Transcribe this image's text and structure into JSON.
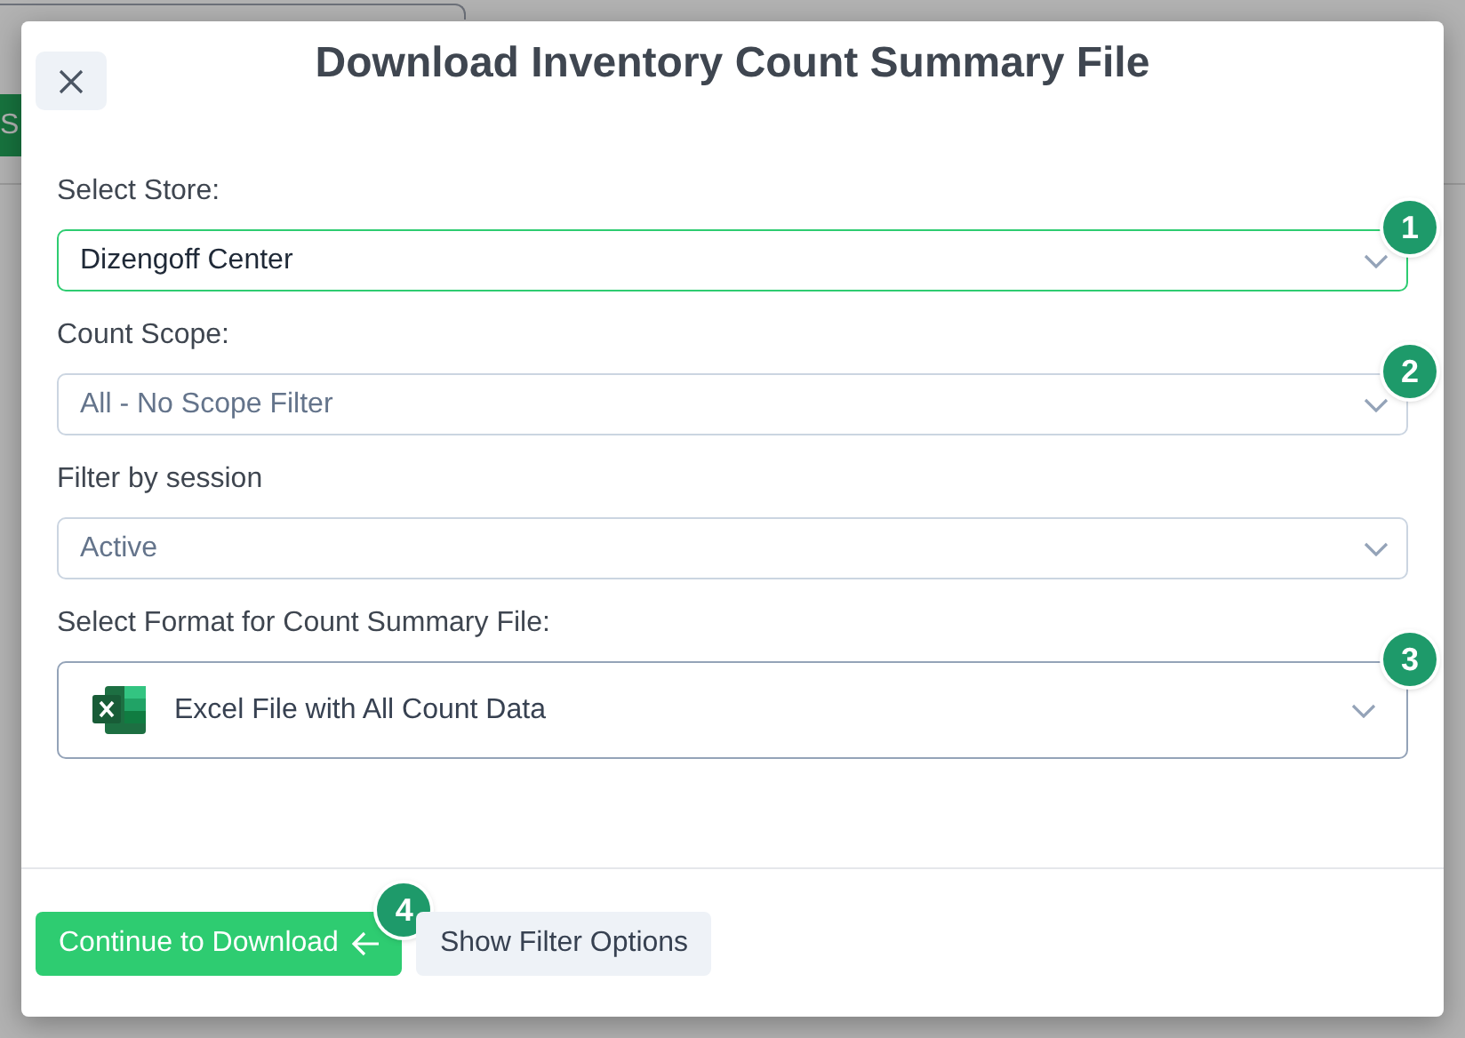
{
  "background": {
    "button_label": "S"
  },
  "dialog": {
    "title": "Download Inventory Count Summary File",
    "fields": [
      {
        "kind": "select",
        "label": "Select Store:",
        "value": "Dizengoff Center",
        "focused": true,
        "badge": "1"
      },
      {
        "kind": "select",
        "label": "Count Scope:",
        "value": "All - No Scope Filter",
        "focused": false,
        "badge": "2"
      },
      {
        "kind": "select",
        "label": "Filter by session",
        "value": "Active",
        "focused": false
      },
      {
        "kind": "format",
        "label": "Select Format for Count Summary File:",
        "value": "Excel File with All Count Data",
        "focused": false,
        "badge": "3"
      }
    ],
    "buttons": [
      {
        "kind": "primary",
        "label": "Continue to Download",
        "badge": "4"
      },
      {
        "kind": "secondary",
        "label": "Show Filter Options"
      }
    ]
  }
}
